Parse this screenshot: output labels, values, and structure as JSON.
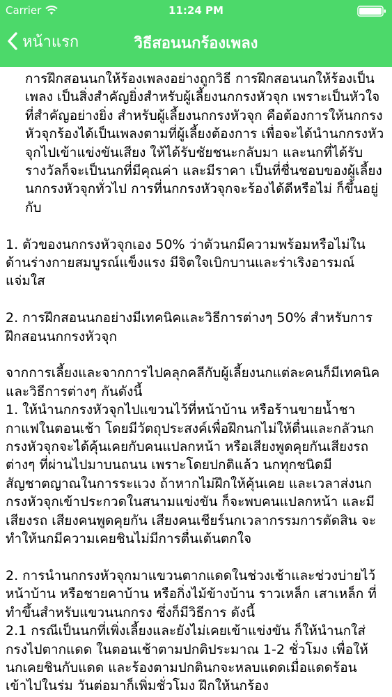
{
  "status_bar": {
    "carrier": "Carrier",
    "time": "11:24 PM"
  },
  "nav_bar": {
    "back_label": "หน้าแรก",
    "title": "วิธีสอนนกร้องเพลง"
  },
  "article": {
    "intro": "การฝึกสอนนกให้ร้องเพลงอย่างถูกวิธี การฝึกสอนนกให้ร้องเป็นเพลง เป็นสิ่งสำคัญยิ่งสำหรับผู้เลี้ยงนกกรงหัวจุก เพราะเป็นหัวใจที่สำคัญอย่างยิ่ง สำหรับผู้เลี้ยงนกกรงหัวจุก คือต้องการให้นกกรงหัวจุกร้องได้เป็นเพลงตามที่ผู้เลี้ยงต้องการ เพื่อจะได้นำนกกรงหัวจุกไปเข้าแข่งขันเสียง ให้ได้รับชัยชนะกลับมา และนกที่ได้รับรางวัลก็จะเป็นนกที่มีคุณค่า และมีราคา เป็นที่ชื่นชอบของผู้เลี้ยงนกกรงหัวจุกทั่วไป การที่นกกรงหัวจุกจะร้องได้ดีหรือไม่ ก็ขึ้นอยู่กับ",
    "point1": "1. ตัวของนกกรงหัวจุกเอง 50% ว่าตัวนกมีความพร้อมหรือไม่ในด้านร่างกายสมบูรณ์แข็งแรง มีจิตใจเบิกบานและร่าเริงอารมณ์แจ่มใส",
    "point2": "2. การฝึกสอนนกอย่างมีเทคนิคและวิธีการต่างๆ 50% สำหรับการฝึกสอนนกกรงหัวจุก",
    "lead": "จากการเลี้ยงและจากการไปคลุกคลีกับผู้เลี้ยงนกแต่ละคนก็มีเทคนิคและวิธีการต่างๆ กันดังนี้",
    "step1": "1. ให้นำนกกรงหัวจุกไปแขวนไว้ที่หน้าบ้าน หรือร้านขายน้ำชากาแฟในตอนเช้า โดยมีวัตถุประสงค์เพื่อฝึกนกไม่ให้ตื่นและกลัวนกกรงหัวจุกจะได้คุ้นเคยกับคนแปลกหน้า หรือเสียงพูดคุยกันเสียงรถต่างๆ ที่ผ่านไปมาบนถนน เพราะโดยปกติแล้ว นกทุกชนิดมีสัญชาตญาณในการระแวง ถ้าหากไม่ฝึกให้คุ้นเคย และเวลาส่งนกกรงหัวจุกเข้าประกวดในสนามแข่งขัน ก็จะพบคนแปลกหน้า และมีเสียงรถ เสียงคนพูดคุยกัน เสียงคนเชียร์นกเวลากรรมการตัดสิน จะทำให้นกมีความเคยชินไม่มีการตื่นเต้นตกใจ",
    "step2": "2. การนำนกกรงหัวจุกมาแขวนตากแดดในช่วงเช้าและช่วงบ่ายไว้หน้าบ้าน หรือชายคาบ้าน หรือกิ่งไม้ข้างบ้าน ราวเหล็ก เสาเหล็ก ที่ทำขึ้นสำหรับแขวนนกกรง ซึ่งก็มีวิธีการ ดังนี้",
    "step2_1": "2.1 กรณีเป็นนกที่เพิ่งเลี้ยงและยังไม่เคยเข้าแข่งขัน ก็ให้นำนกใส่กรงไปตากแดด ในตอนเช้าตามปกติประมาณ 1-2 ชั่วโมง เพื่อให้นกเคยชินกับแดด และร้องตามปกตินกจะหลบแดดเมื่อแดดร้อนเข้าไปในร่ม วันต่อมาก็เพิ่มชั่วโมง ฝึกให้นกร้อง"
  },
  "colors": {
    "header_green": "#4cd96a",
    "text": "#000000"
  }
}
